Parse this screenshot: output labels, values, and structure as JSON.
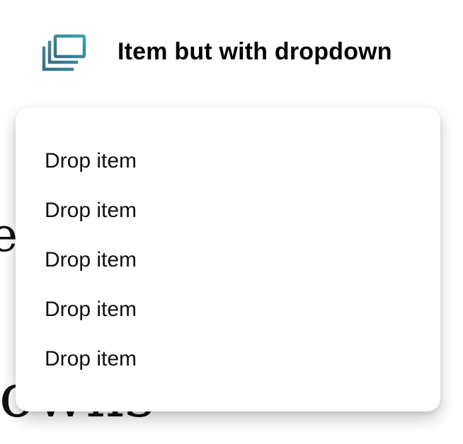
{
  "nav": {
    "label": "Item but with dropdown",
    "icon": "stacked-windows-icon",
    "icon_colors": {
      "front": "#3a8fa3",
      "back": "#3d6e86"
    }
  },
  "dropdown": {
    "items": [
      {
        "label": "Drop item"
      },
      {
        "label": "Drop item"
      },
      {
        "label": "Drop item"
      },
      {
        "label": "Drop item"
      },
      {
        "label": "Drop item"
      }
    ]
  },
  "background": {
    "fragment_1": "e",
    "fragment_2": "lowns"
  }
}
